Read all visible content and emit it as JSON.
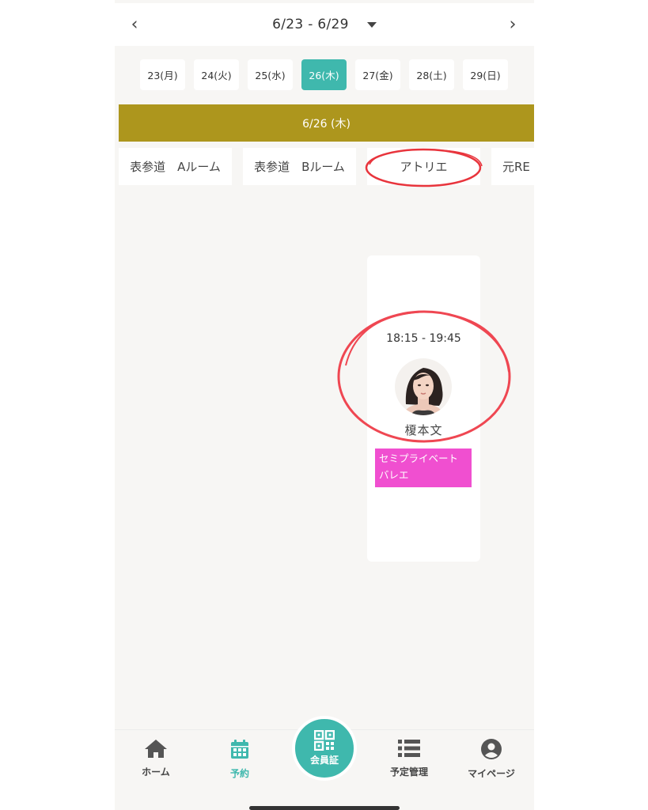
{
  "header": {
    "week_range": "6/23 - 6/29",
    "prev_icon": "chevron-left-icon",
    "next_icon": "chevron-right-icon"
  },
  "days": [
    {
      "label": "23(月)",
      "active": false
    },
    {
      "label": "24(火)",
      "active": false
    },
    {
      "label": "25(水)",
      "active": false
    },
    {
      "label": "26(木)",
      "active": true
    },
    {
      "label": "27(金)",
      "active": false
    },
    {
      "label": "28(土)",
      "active": false
    },
    {
      "label": "29(日)",
      "active": false
    }
  ],
  "date_bar": "6/26 (木)",
  "rooms": [
    "表参道　Aルーム",
    "表参道　Bルーム",
    "アトリエ",
    "元RE"
  ],
  "lesson": {
    "time": "18:15 - 19:45",
    "instructor": "榎本文",
    "tag_line1": "セミプライベート",
    "tag_line2": "バレエ"
  },
  "bottom_nav": {
    "home": "ホーム",
    "reserve": "予約",
    "member_card": "会員証",
    "schedule": "予定管理",
    "mypage": "マイページ"
  },
  "colors": {
    "accent": "#3fb8ad",
    "date_bar": "#ad961d",
    "tag": "#f04fd0",
    "annotation": "#e8343c"
  }
}
